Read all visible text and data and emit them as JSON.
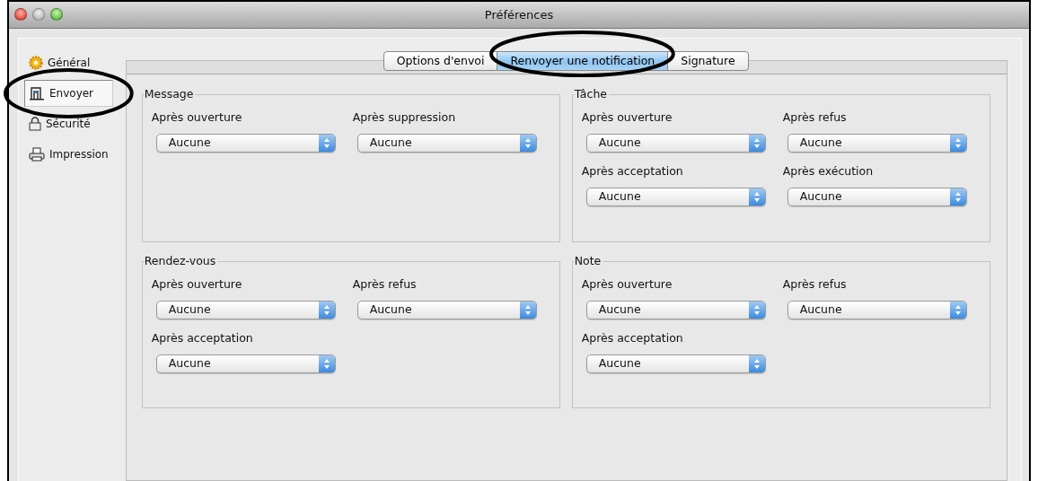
{
  "window": {
    "title": "Préférences"
  },
  "sidebar": {
    "items": [
      {
        "label": "Général",
        "kind": "gear",
        "selected": false,
        "circled": false
      },
      {
        "label": "Envoyer",
        "kind": "send",
        "selected": true,
        "circled": true
      },
      {
        "label": "Sécurité",
        "kind": "lock",
        "selected": false,
        "circled": false
      },
      {
        "label": "Impression",
        "kind": "printer",
        "selected": false,
        "circled": false
      }
    ]
  },
  "tab_bar": {
    "circled": true,
    "tabs": [
      {
        "label": "Options d'envoi",
        "selected": false
      },
      {
        "label": "Renvoyer une notification",
        "selected": true
      },
      {
        "label": "Signature",
        "selected": false
      }
    ]
  },
  "groups": [
    {
      "title": "Message",
      "fields": [
        {
          "label": "Après ouverture",
          "value": "Aucune"
        },
        {
          "label": "Après suppression",
          "value": "Aucune"
        }
      ]
    },
    {
      "title": "Tâche",
      "fields": [
        {
          "label": "Après ouverture",
          "value": "Aucune"
        },
        {
          "label": "Après refus",
          "value": "Aucune"
        },
        {
          "label": "Après acceptation",
          "value": "Aucune"
        },
        {
          "label": "Après exécution",
          "value": "Aucune"
        }
      ]
    },
    {
      "title": "Rendez-vous",
      "fields": [
        {
          "label": "Après ouverture",
          "value": "Aucune"
        },
        {
          "label": "Après refus",
          "value": "Aucune"
        },
        {
          "label": "Après acceptation",
          "value": "Aucune"
        }
      ]
    },
    {
      "title": "Note",
      "fields": [
        {
          "label": "Après ouverture",
          "value": "Aucune"
        },
        {
          "label": "Après refus",
          "value": "Aucune"
        },
        {
          "label": "Après acceptation",
          "value": "Aucune"
        }
      ]
    }
  ]
}
